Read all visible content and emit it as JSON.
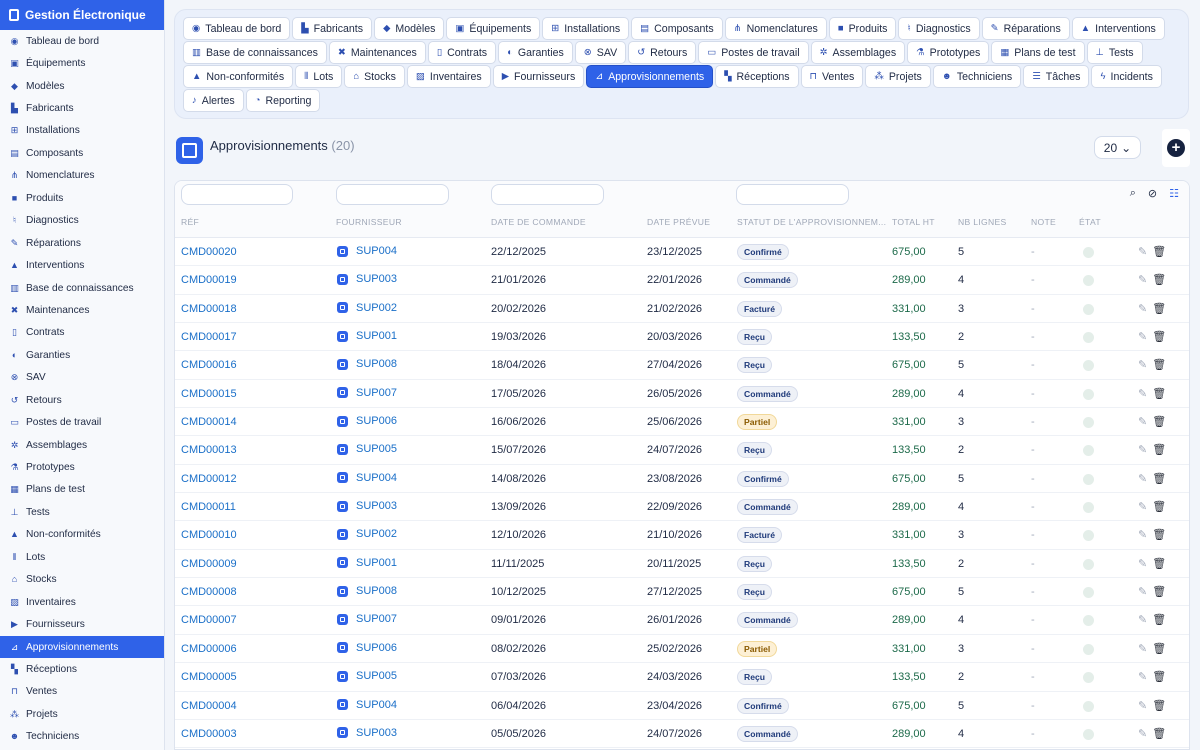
{
  "brand": {
    "title": "Gestion Électronique",
    "icon": "chip-icon"
  },
  "sidebar": {
    "items": [
      {
        "label": "Tableau de bord",
        "icon": "gauge-icon",
        "glyph": "◉"
      },
      {
        "label": "Équipements",
        "icon": "chip-icon",
        "glyph": "▣"
      },
      {
        "label": "Modèles",
        "icon": "cube-icon",
        "glyph": "◆"
      },
      {
        "label": "Fabricants",
        "icon": "factory-icon",
        "glyph": "▙"
      },
      {
        "label": "Installations",
        "icon": "network-icon",
        "glyph": "⊞"
      },
      {
        "label": "Composants",
        "icon": "memory-icon",
        "glyph": "▤"
      },
      {
        "label": "Nomenclatures",
        "icon": "sitemap-icon",
        "glyph": "⋔"
      },
      {
        "label": "Produits",
        "icon": "box-icon",
        "glyph": "■"
      },
      {
        "label": "Diagnostics",
        "icon": "stethoscope-icon",
        "glyph": "♮"
      },
      {
        "label": "Réparations",
        "icon": "wrench-icon",
        "glyph": "✎"
      },
      {
        "label": "Interventions",
        "icon": "helmet-icon",
        "glyph": "▲"
      },
      {
        "label": "Base de connaissances",
        "icon": "book-icon",
        "glyph": "▥"
      },
      {
        "label": "Maintenances",
        "icon": "tools-icon",
        "glyph": "✖"
      },
      {
        "label": "Contrats",
        "icon": "file-icon",
        "glyph": "▯"
      },
      {
        "label": "Garanties",
        "icon": "shield-icon",
        "glyph": "◐"
      },
      {
        "label": "SAV",
        "icon": "lifebuoy-icon",
        "glyph": "⊗"
      },
      {
        "label": "Retours",
        "icon": "undo-icon",
        "glyph": "↺"
      },
      {
        "label": "Postes de travail",
        "icon": "desktop-icon",
        "glyph": "▭"
      },
      {
        "label": "Assemblages",
        "icon": "cogs-icon",
        "glyph": "✲"
      },
      {
        "label": "Prototypes",
        "icon": "flask-icon",
        "glyph": "⚗"
      },
      {
        "label": "Plans de test",
        "icon": "clipboard-icon",
        "glyph": "▦"
      },
      {
        "label": "Tests",
        "icon": "vial-icon",
        "glyph": "⊥"
      },
      {
        "label": "Non-conformités",
        "icon": "warning-icon",
        "glyph": "▲"
      },
      {
        "label": "Lots",
        "icon": "barcode-icon",
        "glyph": "⦀"
      },
      {
        "label": "Stocks",
        "icon": "warehouse-icon",
        "glyph": "⌂"
      },
      {
        "label": "Inventaires",
        "icon": "clipboard-check-icon",
        "glyph": "▨"
      },
      {
        "label": "Fournisseurs",
        "icon": "truck-icon",
        "glyph": "▶"
      },
      {
        "label": "Approvisionnements",
        "icon": "dolly-icon",
        "glyph": "⊿",
        "active": true
      },
      {
        "label": "Réceptions",
        "icon": "truck-loading-icon",
        "glyph": "▚"
      },
      {
        "label": "Ventes",
        "icon": "cart-icon",
        "glyph": "⊓"
      },
      {
        "label": "Projets",
        "icon": "project-diagram-icon",
        "glyph": "⁂"
      },
      {
        "label": "Techniciens",
        "icon": "user-cog-icon",
        "glyph": "☻"
      }
    ]
  },
  "tabs": [
    {
      "label": "Tableau de bord",
      "icon": "gauge-icon",
      "glyph": "◉"
    },
    {
      "label": "Fabricants",
      "icon": "factory-icon",
      "glyph": "▙"
    },
    {
      "label": "Modèles",
      "icon": "cube-icon",
      "glyph": "◆"
    },
    {
      "label": "Équipements",
      "icon": "chip-icon",
      "glyph": "▣"
    },
    {
      "label": "Installations",
      "icon": "network-icon",
      "glyph": "⊞"
    },
    {
      "label": "Composants",
      "icon": "memory-icon",
      "glyph": "▤"
    },
    {
      "label": "Nomenclatures",
      "icon": "sitemap-icon",
      "glyph": "⋔"
    },
    {
      "label": "Produits",
      "icon": "box-icon",
      "glyph": "■"
    },
    {
      "label": "Diagnostics",
      "icon": "stethoscope-icon",
      "glyph": "♮"
    },
    {
      "label": "Réparations",
      "icon": "wrench-icon",
      "glyph": "✎"
    },
    {
      "label": "Interventions",
      "icon": "helmet-icon",
      "glyph": "▲"
    },
    {
      "label": "Base de connaissances",
      "icon": "book-icon",
      "glyph": "▥"
    },
    {
      "label": "Maintenances",
      "icon": "tools-icon",
      "glyph": "✖"
    },
    {
      "label": "Contrats",
      "icon": "file-icon",
      "glyph": "▯"
    },
    {
      "label": "Garanties",
      "icon": "shield-icon",
      "glyph": "◐"
    },
    {
      "label": "SAV",
      "icon": "lifebuoy-icon",
      "glyph": "⊗"
    },
    {
      "label": "Retours",
      "icon": "undo-icon",
      "glyph": "↺"
    },
    {
      "label": "Postes de travail",
      "icon": "desktop-icon",
      "glyph": "▭"
    },
    {
      "label": "Assemblages",
      "icon": "cogs-icon",
      "glyph": "✲"
    },
    {
      "label": "Prototypes",
      "icon": "flask-icon",
      "glyph": "⚗"
    },
    {
      "label": "Plans de test",
      "icon": "clipboard-icon",
      "glyph": "▦"
    },
    {
      "label": "Tests",
      "icon": "vial-icon",
      "glyph": "⊥"
    },
    {
      "label": "Non-conformités",
      "icon": "warning-icon",
      "glyph": "▲"
    },
    {
      "label": "Lots",
      "icon": "barcode-icon",
      "glyph": "⦀"
    },
    {
      "label": "Stocks",
      "icon": "warehouse-icon",
      "glyph": "⌂"
    },
    {
      "label": "Inventaires",
      "icon": "clipboard-check-icon",
      "glyph": "▨"
    },
    {
      "label": "Fournisseurs",
      "icon": "truck-icon",
      "glyph": "▶"
    },
    {
      "label": "Approvisionnements",
      "icon": "dolly-icon",
      "glyph": "⊿",
      "active": true
    },
    {
      "label": "Réceptions",
      "icon": "truck-loading-icon",
      "glyph": "▚"
    },
    {
      "label": "Ventes",
      "icon": "cart-icon",
      "glyph": "⊓"
    },
    {
      "label": "Projets",
      "icon": "project-diagram-icon",
      "glyph": "⁂"
    },
    {
      "label": "Techniciens",
      "icon": "user-cog-icon",
      "glyph": "☻"
    },
    {
      "label": "Tâches",
      "icon": "tasks-icon",
      "glyph": "☰"
    },
    {
      "label": "Incidents",
      "icon": "bolt-icon",
      "glyph": "ϟ"
    },
    {
      "label": "Alertes",
      "icon": "bell-icon",
      "glyph": "♪"
    },
    {
      "label": "Reporting",
      "icon": "pie-chart-icon",
      "glyph": "◔"
    }
  ],
  "main": {
    "title": "Approvisionnements",
    "count": "(20)",
    "page_size": "20",
    "page_size_arrow": "⌄",
    "add_glyph": "+"
  },
  "toolbar": {
    "search_glyph": "⌕",
    "clear_filter_glyph": "⊘",
    "columns_glyph": "☷"
  },
  "table": {
    "columns": [
      "RÉF",
      "FOURNISSEUR",
      "DATE DE COMMANDE",
      "DATE PRÉVUE",
      "STATUT DE L'APPROVISIONNEM...",
      "TOTAL HT",
      "NB LIGNES",
      "NOTE",
      "ÉTAT"
    ],
    "rows": [
      {
        "ref": "CMD00020",
        "fournisseur": "SUP004",
        "date_commande": "22/12/2025",
        "date_prevue": "23/12/2025",
        "statut": "Confirmé",
        "total": "675,00",
        "nb": "5",
        "note": "-"
      },
      {
        "ref": "CMD00019",
        "fournisseur": "SUP003",
        "date_commande": "21/01/2026",
        "date_prevue": "22/01/2026",
        "statut": "Commandé",
        "total": "289,00",
        "nb": "4",
        "note": "-"
      },
      {
        "ref": "CMD00018",
        "fournisseur": "SUP002",
        "date_commande": "20/02/2026",
        "date_prevue": "21/02/2026",
        "statut": "Facturé",
        "total": "331,00",
        "nb": "3",
        "note": "-"
      },
      {
        "ref": "CMD00017",
        "fournisseur": "SUP001",
        "date_commande": "19/03/2026",
        "date_prevue": "20/03/2026",
        "statut": "Reçu",
        "total": "133,50",
        "nb": "2",
        "note": "-"
      },
      {
        "ref": "CMD00016",
        "fournisseur": "SUP008",
        "date_commande": "18/04/2026",
        "date_prevue": "27/04/2026",
        "statut": "Reçu",
        "total": "675,00",
        "nb": "5",
        "note": "-"
      },
      {
        "ref": "CMD00015",
        "fournisseur": "SUP007",
        "date_commande": "17/05/2026",
        "date_prevue": "26/05/2026",
        "statut": "Commandé",
        "total": "289,00",
        "nb": "4",
        "note": "-"
      },
      {
        "ref": "CMD00014",
        "fournisseur": "SUP006",
        "date_commande": "16/06/2026",
        "date_prevue": "25/06/2026",
        "statut": "Partiel",
        "total": "331,00",
        "nb": "3",
        "note": "-"
      },
      {
        "ref": "CMD00013",
        "fournisseur": "SUP005",
        "date_commande": "15/07/2026",
        "date_prevue": "24/07/2026",
        "statut": "Reçu",
        "total": "133,50",
        "nb": "2",
        "note": "-"
      },
      {
        "ref": "CMD00012",
        "fournisseur": "SUP004",
        "date_commande": "14/08/2026",
        "date_prevue": "23/08/2026",
        "statut": "Confirmé",
        "total": "675,00",
        "nb": "5",
        "note": "-"
      },
      {
        "ref": "CMD00011",
        "fournisseur": "SUP003",
        "date_commande": "13/09/2026",
        "date_prevue": "22/09/2026",
        "statut": "Commandé",
        "total": "289,00",
        "nb": "4",
        "note": "-"
      },
      {
        "ref": "CMD00010",
        "fournisseur": "SUP002",
        "date_commande": "12/10/2026",
        "date_prevue": "21/10/2026",
        "statut": "Facturé",
        "total": "331,00",
        "nb": "3",
        "note": "-"
      },
      {
        "ref": "CMD00009",
        "fournisseur": "SUP001",
        "date_commande": "11/11/2025",
        "date_prevue": "20/11/2025",
        "statut": "Reçu",
        "total": "133,50",
        "nb": "2",
        "note": "-"
      },
      {
        "ref": "CMD00008",
        "fournisseur": "SUP008",
        "date_commande": "10/12/2025",
        "date_prevue": "27/12/2025",
        "statut": "Reçu",
        "total": "675,00",
        "nb": "5",
        "note": "-"
      },
      {
        "ref": "CMD00007",
        "fournisseur": "SUP007",
        "date_commande": "09/01/2026",
        "date_prevue": "26/01/2026",
        "statut": "Commandé",
        "total": "289,00",
        "nb": "4",
        "note": "-"
      },
      {
        "ref": "CMD00006",
        "fournisseur": "SUP006",
        "date_commande": "08/02/2026",
        "date_prevue": "25/02/2026",
        "statut": "Partiel",
        "total": "331,00",
        "nb": "3",
        "note": "-"
      },
      {
        "ref": "CMD00005",
        "fournisseur": "SUP005",
        "date_commande": "07/03/2026",
        "date_prevue": "24/03/2026",
        "statut": "Reçu",
        "total": "133,50",
        "nb": "2",
        "note": "-"
      },
      {
        "ref": "CMD00004",
        "fournisseur": "SUP004",
        "date_commande": "06/04/2026",
        "date_prevue": "23/04/2026",
        "statut": "Confirmé",
        "total": "675,00",
        "nb": "5",
        "note": "-"
      },
      {
        "ref": "CMD00003",
        "fournisseur": "SUP003",
        "date_commande": "05/05/2026",
        "date_prevue": "24/07/2026",
        "statut": "Commandé",
        "total": "289,00",
        "nb": "4",
        "note": "-"
      }
    ]
  },
  "row_actions": {
    "edit_glyph": "✎",
    "delete_glyph": "🗑"
  },
  "colors": {
    "accent": "#2f62e8",
    "link": "#1a6fc8",
    "money": "#1d6a4a",
    "partiel_bg": "#fdf0d5"
  }
}
